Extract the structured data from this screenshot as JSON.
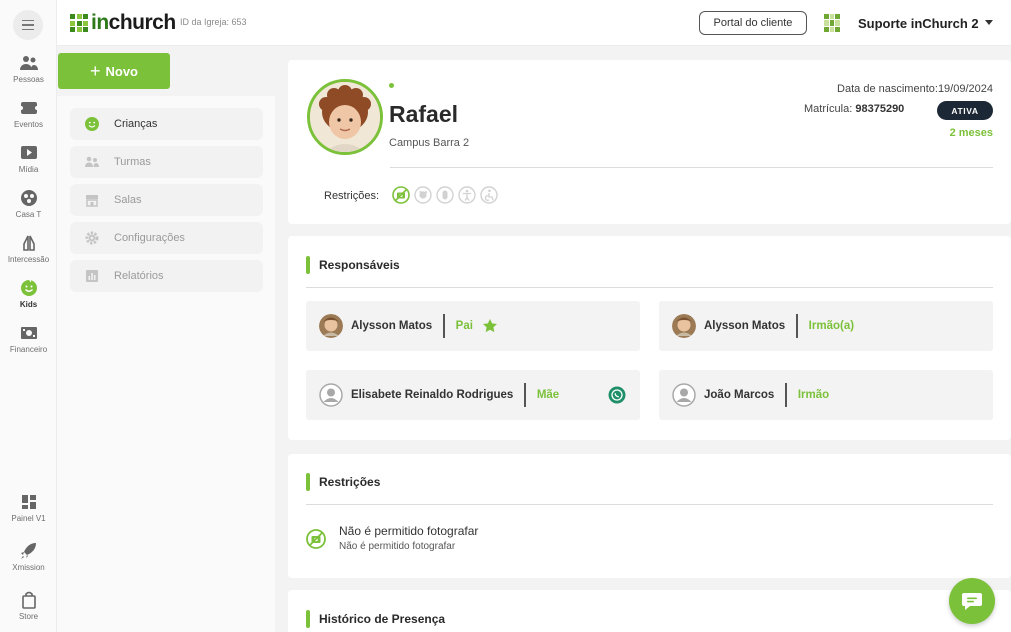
{
  "app": {
    "logo_text_accent": "in",
    "logo_text_rest": "church",
    "church_id": "ID da Igreja: 653"
  },
  "colors": {
    "accent": "#7cc13a",
    "badge_dark": "#1d2836",
    "logo_green": "#2d7a1a"
  },
  "header": {
    "portal_label": "Portal do cliente",
    "org_name": "Suporte inChurch 2",
    "org_icon": "grid-logo-icon",
    "caret_icon": "caret-down-icon"
  },
  "rail": {
    "menu_icon": "hamburger-icon",
    "items": [
      {
        "label": "Pessoas",
        "icon": "people-icon"
      },
      {
        "label": "Eventos",
        "icon": "ticket-icon"
      },
      {
        "label": "Mídia",
        "icon": "play-icon"
      },
      {
        "label": "Casa T",
        "icon": "home-group-icon"
      },
      {
        "label": "Intercessão",
        "icon": "praying-hands-icon"
      },
      {
        "label": "Kids",
        "icon": "smile-icon"
      },
      {
        "label": "Financeiro",
        "icon": "money-icon"
      },
      {
        "label": "Painel V1",
        "icon": "dashboard-icon"
      },
      {
        "label": "Xmission",
        "icon": "rocket-icon"
      },
      {
        "label": "Store",
        "icon": "bag-icon"
      }
    ]
  },
  "submenu": {
    "new_label": "Novo",
    "items": [
      {
        "label": "Crianças",
        "icon": "smile-icon"
      },
      {
        "label": "Turmas",
        "icon": "group-icon"
      },
      {
        "label": "Salas",
        "icon": "room-icon"
      },
      {
        "label": "Configurações",
        "icon": "gear-icon"
      },
      {
        "label": "Relatórios",
        "icon": "report-icon"
      }
    ]
  },
  "profile": {
    "name": "Rafael",
    "campus": "Campus Barra 2",
    "birth_date": "Data de nascimento:19/09/2024",
    "matricula_label": "Matrícula:",
    "matricula_value": "98375290",
    "status": "ATIVA",
    "age": "2 meses",
    "restrictions_label": "Restrições:",
    "restriction_icons": [
      "no-photo-icon",
      "allergy-icon",
      "food-icon",
      "disability-icon",
      "accessibility-icon"
    ]
  },
  "responsaveis": {
    "title": "Responsáveis",
    "items": [
      {
        "name": "Alysson Matos",
        "relation": "Pai",
        "extra_icon": "star-icon"
      },
      {
        "name": "Alysson Matos",
        "relation": "Irmão(a)"
      },
      {
        "name": "Elisabete Reinaldo Rodrigues",
        "relation": "Mãe",
        "extra_icon": "whatsapp-icon"
      },
      {
        "name": "João Marcos",
        "relation": "Irmão"
      }
    ]
  },
  "restricoes": {
    "title": "Restrições",
    "items": [
      {
        "title": "Não é permitido fotografar",
        "subtitle": "Não é permitido fotografar",
        "icon": "no-photo-icon"
      }
    ]
  },
  "historico": {
    "title": "Histórico de Presença"
  },
  "chat": {
    "icon": "chat-icon"
  }
}
